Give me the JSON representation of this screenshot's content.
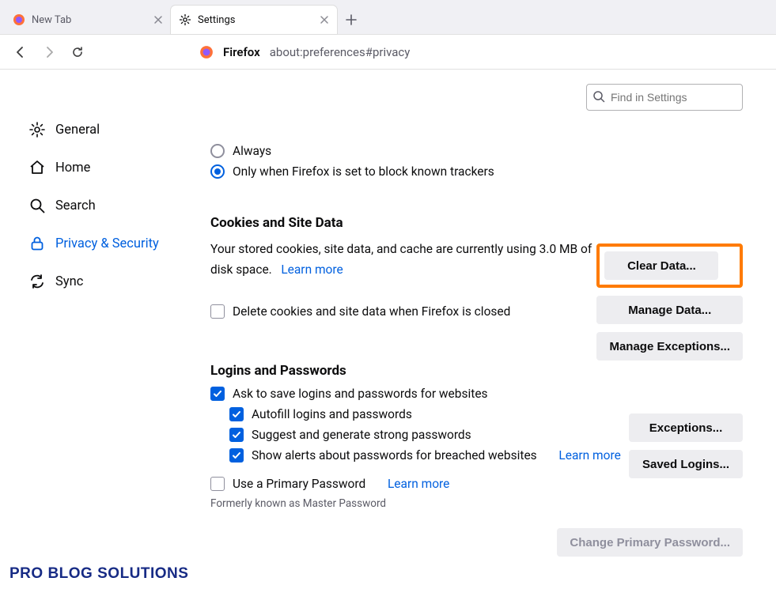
{
  "tabs": [
    {
      "label": "New Tab",
      "active": false
    },
    {
      "label": "Settings",
      "active": true
    }
  ],
  "url": {
    "context": "Firefox",
    "path": "about:preferences#privacy"
  },
  "search": {
    "placeholder": "Find in Settings"
  },
  "sidebar": {
    "items": [
      {
        "label": "General"
      },
      {
        "label": "Home"
      },
      {
        "label": "Search"
      },
      {
        "label": "Privacy & Security"
      },
      {
        "label": "Sync"
      }
    ]
  },
  "dnt": {
    "always": "Always",
    "only": "Only when Firefox is set to block known trackers"
  },
  "cookies": {
    "title": "Cookies and Site Data",
    "desc1": "Your stored cookies, site data, and cache are currently using 3.0 MB of disk space.",
    "learn": "Learn more",
    "delete_on_close": "Delete cookies and site data when Firefox is closed",
    "btn_clear": "Clear Data...",
    "btn_manage": "Manage Data...",
    "btn_exceptions": "Manage Exceptions..."
  },
  "logins": {
    "title": "Logins and Passwords",
    "ask": "Ask to save logins and passwords for websites",
    "autofill": "Autofill logins and passwords",
    "suggest": "Suggest and generate strong passwords",
    "alerts": "Show alerts about passwords for breached websites",
    "learn": "Learn more",
    "primary": "Use a Primary Password",
    "primary_learn": "Learn more",
    "formerly": "Formerly known as Master Password",
    "btn_exceptions": "Exceptions...",
    "btn_saved": "Saved Logins...",
    "btn_change": "Change Primary Password..."
  },
  "watermark": "PRO BLOG SOLUTIONS"
}
